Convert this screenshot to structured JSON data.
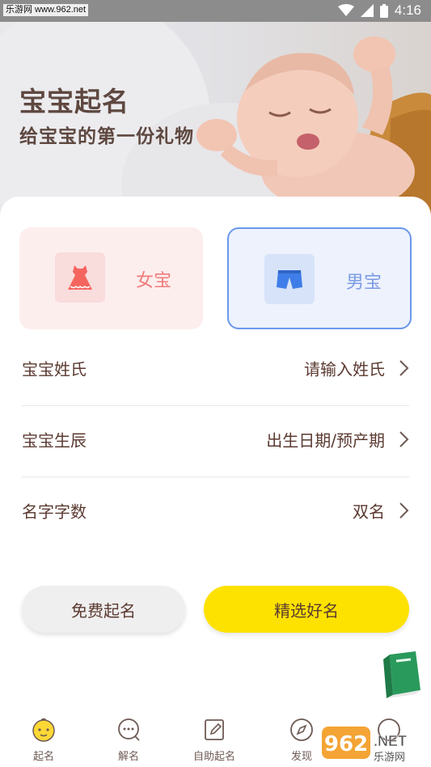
{
  "status_bar": {
    "watermark": "乐游网 www.962.net",
    "time": "4:16"
  },
  "hero": {
    "title": "宝宝起名",
    "subtitle": "给宝宝的第一份礼物"
  },
  "gender": {
    "girl": {
      "label": "女宝",
      "icon": "dress-icon"
    },
    "boy": {
      "label": "男宝",
      "icon": "shorts-icon",
      "selected": true
    }
  },
  "form": {
    "surname": {
      "label": "宝宝姓氏",
      "value": "请输入姓氏"
    },
    "birth": {
      "label": "宝宝生辰",
      "value": "出生日期/预产期"
    },
    "length": {
      "label": "名字字数",
      "value": "双名"
    }
  },
  "buttons": {
    "free": "免费起名",
    "premium": "精选好名"
  },
  "nav": {
    "items": [
      {
        "label": "起名",
        "icon": "baby-face-icon",
        "active": true
      },
      {
        "label": "解名",
        "icon": "chat-bubble-icon"
      },
      {
        "label": "自助起名",
        "icon": "edit-icon"
      },
      {
        "label": "发现",
        "icon": "compass-icon"
      },
      {
        "label": "",
        "icon": "profile-icon"
      }
    ]
  },
  "corner_watermark": {
    "brand": "962",
    "suffix": ".NET",
    "site": "乐游网"
  },
  "colors": {
    "accent_yellow": "#fde200",
    "girl_pink": "#f07c7c",
    "boy_blue": "#6b98ea",
    "text_brown": "#5b3a31"
  }
}
